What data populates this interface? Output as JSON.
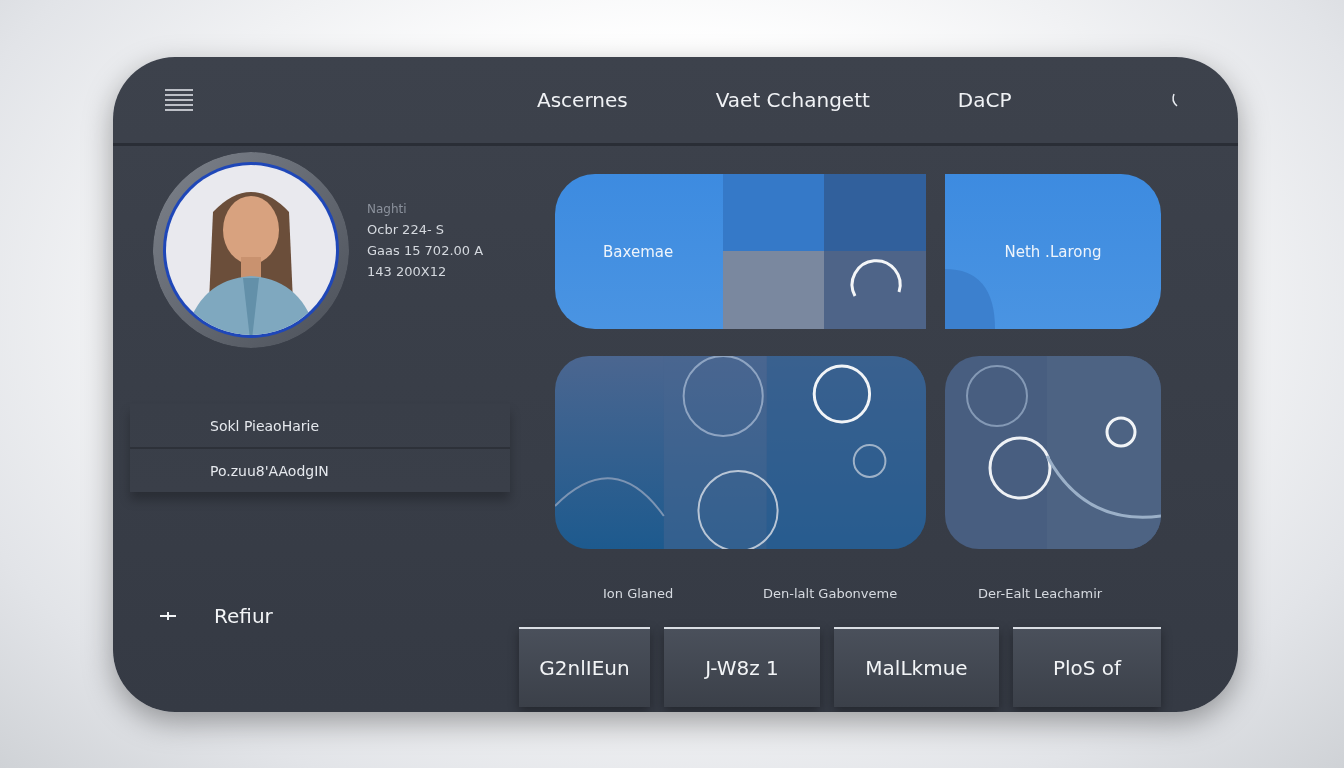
{
  "nav": [
    "Ascernes",
    "Vaet Cchangett",
    "DaCP"
  ],
  "profile": {
    "caption": "Naghti",
    "lines": [
      "Ocbr 224- S",
      "Gaas 15 702.00 A",
      "143 200X12"
    ]
  },
  "menu": [
    "Sokl PieaoHarie",
    "Po.zuu8'AAodgIN"
  ],
  "action": "Refiur",
  "tiles": [
    "Baxemae",
    "Neth .Larong"
  ],
  "captions": [
    "Ion Glaned",
    "Den-lalt Gabonveme",
    "Der-Ealt Leachamir"
  ],
  "buttons": [
    "G2nlIEun",
    "J-W8z 1",
    "MalLkmue",
    "PloS of"
  ]
}
